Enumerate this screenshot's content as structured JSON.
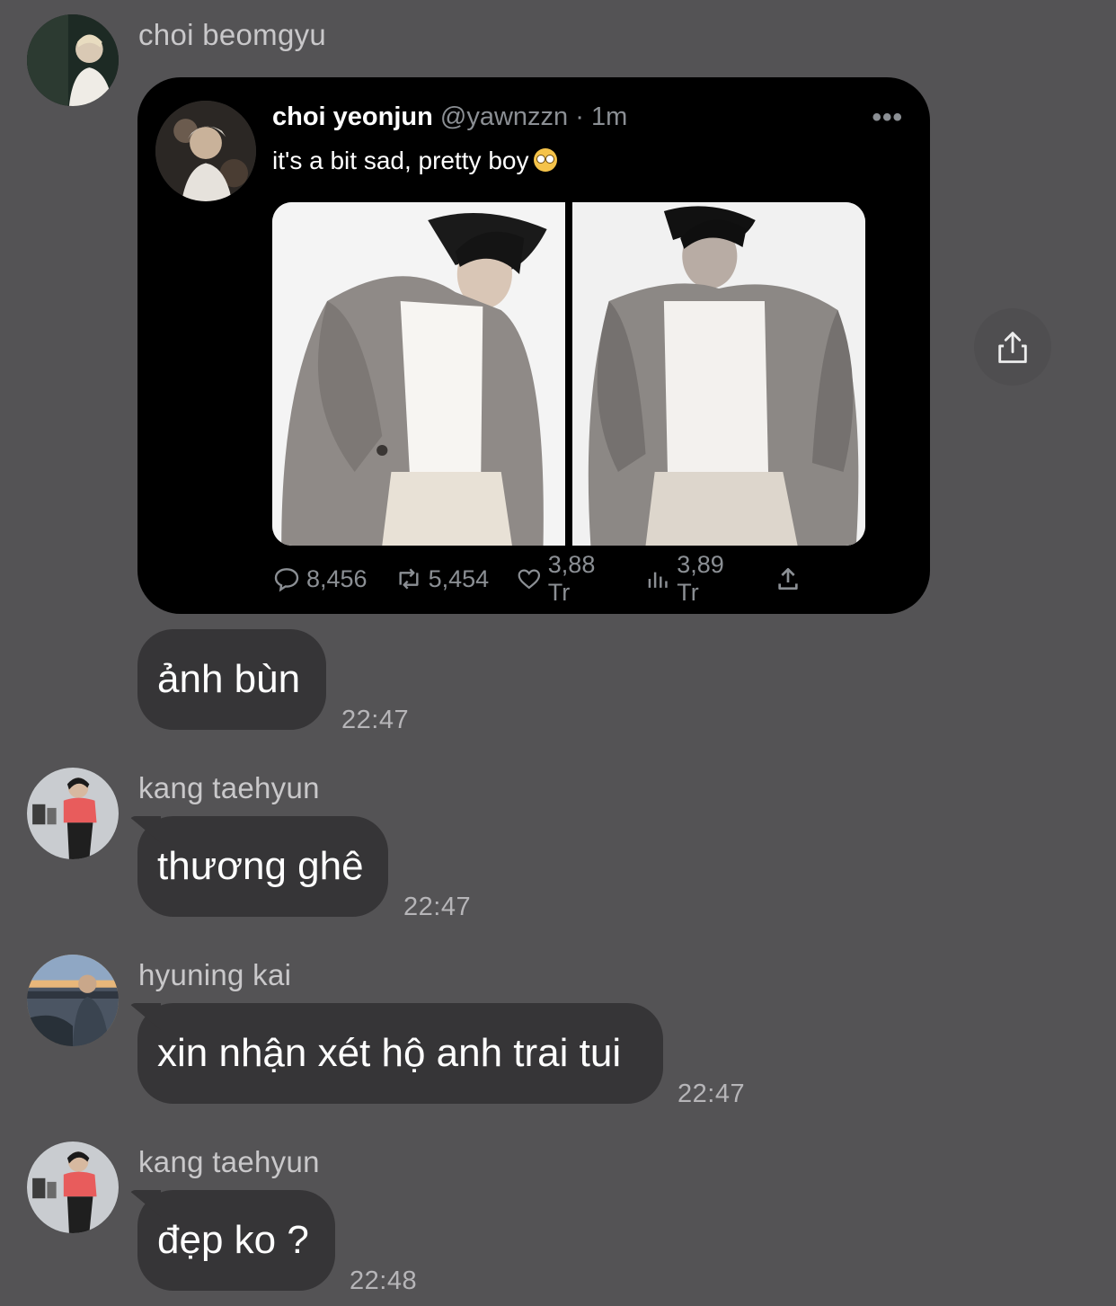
{
  "messages": [
    {
      "sender": "choi beomgyu",
      "tweet": {
        "name": "choi yeonjun",
        "handle": "@yawnzzn · 1m",
        "more": "•••",
        "text": "it's a bit sad, pretty boy",
        "emoji": "face-with-rolling-eyes",
        "stats": {
          "replies": "8,456",
          "retweets": "5,454",
          "likes": "3,88 Tr",
          "views": "3,89 Tr"
        }
      },
      "bubble": "ảnh bùn",
      "time": "22:47"
    },
    {
      "sender": "kang taehyun",
      "bubble": "thương ghê",
      "time": "22:47"
    },
    {
      "sender": "hyuning kai",
      "bubble": "xin nhận xét hộ anh trai tui",
      "time": "22:47"
    },
    {
      "sender": "kang taehyun",
      "bubble": "đẹp ko ?",
      "time": "22:48"
    }
  ],
  "colors": {
    "background": "#545355",
    "bubble": "#363537",
    "tweet_background": "#000000",
    "muted_text": "#8b8f94"
  },
  "icons": {
    "forward": "share-up-icon"
  }
}
